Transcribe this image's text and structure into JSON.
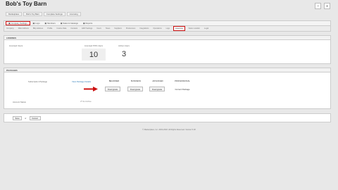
{
  "header": {
    "store_name": "Bob's Toy Barn",
    "help_icon": "?",
    "close_icon": "✕"
  },
  "breadcrumbs": [
    "Marketplace",
    "Bob's Toy Barn",
    "Complete Settings",
    "Licensing"
  ],
  "tabs": [
    {
      "label": "Company Settings",
      "icon": "▣",
      "active": true
    },
    {
      "label": "Logo",
      "icon": "▣",
      "active": false
    },
    {
      "label": "Members",
      "icon": "▣",
      "active": false
    },
    {
      "label": "Sales & Catalogs",
      "icon": "▣",
      "active": false
    },
    {
      "label": "Reports",
      "icon": "▣",
      "active": false
    }
  ],
  "subtabs": [
    {
      "label": "Company",
      "active": false
    },
    {
      "label": "Main Address",
      "active": false
    },
    {
      "label": "Bilty Address",
      "active": false
    },
    {
      "label": "Profile",
      "active": false
    },
    {
      "label": "Invoice Data",
      "active": false
    },
    {
      "label": "Contacts",
      "active": false
    },
    {
      "label": "EMV Settings",
      "active": false
    },
    {
      "label": "Users",
      "active": false
    },
    {
      "label": "Taxes",
      "active": false
    },
    {
      "label": "Suppliers",
      "active": false
    },
    {
      "label": "Preferences",
      "active": false
    },
    {
      "label": "Integrations",
      "active": false
    },
    {
      "label": "Operations",
      "active": false
    },
    {
      "label": "Logs",
      "active": false
    },
    {
      "label": "Licensing",
      "active": true
    },
    {
      "label": "Sales Location",
      "active": false
    },
    {
      "label": "Legal",
      "active": false
    }
  ],
  "licenses": {
    "section_title": "Licenses",
    "label": "Licensed Users",
    "users_label": "Licensed POS Users",
    "users_value": "10",
    "active_label": "Active Users",
    "active_value": "3"
  },
  "packages": {
    "section_title": "Packages",
    "row_label": "Subscription Package",
    "link": "View Package Details",
    "columns": [
      {
        "name": "BEGINNER",
        "action": "Downgrade",
        "current": false
      },
      {
        "name": "BUSINESS",
        "action": "Downgrade",
        "current": false
      },
      {
        "name": "ADVANCED",
        "action": "Downgrade",
        "current": false
      },
      {
        "name": "PROFESSIONAL",
        "action": "Current Package",
        "current": true
      }
    ],
    "second_label": "Account Status",
    "second_value": "✗ Not Active"
  },
  "actions": {
    "save": "Save",
    "or": "or",
    "cancel": "Cancel"
  },
  "footer": "© Marketplace, Inc. 2000-2018. All Rights Reserved. Version 5.18",
  "colors": {
    "highlight": "#cc1111",
    "link": "#2a7ab8",
    "arrow": "#cc1111"
  }
}
